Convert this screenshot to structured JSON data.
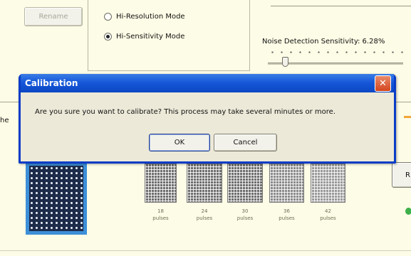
{
  "toolbar": {
    "rename_label": "Rename"
  },
  "mode": {
    "options": [
      {
        "label": "Hi-Resolution Mode",
        "selected": false
      },
      {
        "label": "Hi-Sensitivity Mode",
        "selected": true
      }
    ]
  },
  "noise": {
    "label": "Noise Detection Sensitivity: 6.28%"
  },
  "side_text": {
    "left": "he",
    "right_button": "R"
  },
  "pulses": [
    {
      "value": "18",
      "unit": "pulses"
    },
    {
      "value": "24",
      "unit": "pulses"
    },
    {
      "value": "30",
      "unit": "pulses"
    },
    {
      "value": "36",
      "unit": "pulses"
    },
    {
      "value": "42",
      "unit": "pulses"
    }
  ],
  "dialog": {
    "title": "Calibration",
    "close_glyph": "✕",
    "message": "Are you sure you want to calibrate? This process may take several minutes or more.",
    "ok_label": "OK",
    "cancel_label": "Cancel"
  }
}
